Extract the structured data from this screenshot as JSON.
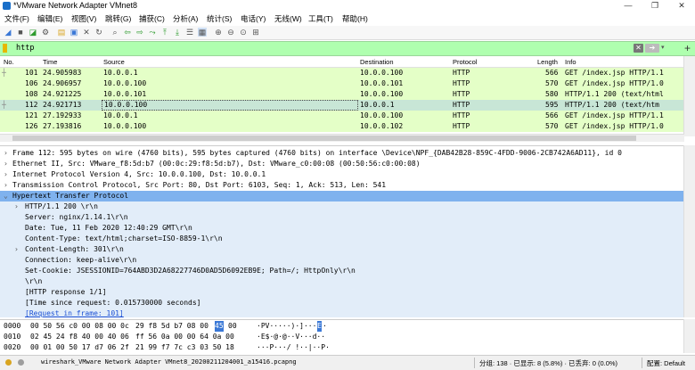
{
  "window": {
    "title": "*VMware Network Adapter VMnet8",
    "min_symbol": "—",
    "max_symbol": "❐",
    "close_symbol": "✕"
  },
  "menu": [
    "文件(F)",
    "编辑(E)",
    "视图(V)",
    "跳转(G)",
    "捕获(C)",
    "分析(A)",
    "统计(S)",
    "电话(Y)",
    "无线(W)",
    "工具(T)",
    "帮助(H)"
  ],
  "toolbar_icons": [
    "shark-fin-start-icon",
    "stop-icon",
    "restart-icon",
    "options-gear-icon",
    "open-file-icon",
    "save-file-icon",
    "close-file-icon",
    "reload-icon",
    "find-icon",
    "back-arrow-icon",
    "forward-arrow-icon",
    "go-to-packet-icon",
    "first-packet-icon",
    "last-packet-icon",
    "autoscroll-icon",
    "colorize-icon",
    "zoom-in-icon",
    "zoom-out-icon",
    "zoom-reset-icon",
    "resize-columns-icon"
  ],
  "filter": {
    "value": "http",
    "clear_symbol": "✕",
    "apply_symbol": "➔",
    "dropdown_symbol": "▾",
    "plus_symbol": "+"
  },
  "packet_list": {
    "columns": [
      "No.",
      "Time",
      "Source",
      "Destination",
      "Protocol",
      "Length",
      "Info"
    ],
    "rows": [
      {
        "no": "101",
        "time": "24.905983",
        "src": "10.0.0.1",
        "dst": "10.0.0.100",
        "proto": "HTTP",
        "len": "566",
        "info": "GET /index.jsp HTTP/1.1"
      },
      {
        "no": "106",
        "time": "24.906957",
        "src": "10.0.0.100",
        "dst": "10.0.0.101",
        "proto": "HTTP",
        "len": "570",
        "info": "GET /index.jsp HTTP/1.0"
      },
      {
        "no": "108",
        "time": "24.921225",
        "src": "10.0.0.101",
        "dst": "10.0.0.100",
        "proto": "HTTP",
        "len": "580",
        "info": "HTTP/1.1 200   (text/html"
      },
      {
        "no": "112",
        "time": "24.921713",
        "src": "10.0.0.100",
        "dst": "10.0.0.1",
        "proto": "HTTP",
        "len": "595",
        "info": "HTTP/1.1 200   (text/htm"
      },
      {
        "no": "121",
        "time": "27.192933",
        "src": "10.0.0.1",
        "dst": "10.0.0.100",
        "proto": "HTTP",
        "len": "566",
        "info": "GET /index.jsp HTTP/1.1"
      },
      {
        "no": "126",
        "time": "27.193816",
        "src": "10.0.0.100",
        "dst": "10.0.0.102",
        "proto": "HTTP",
        "len": "570",
        "info": "GET /index.jsp HTTP/1.0"
      }
    ]
  },
  "details": [
    {
      "arrow": "›",
      "text": "Frame 112: 595 bytes on wire (4760 bits), 595 bytes captured (4760 bits) on interface \\Device\\NPF_{DAB42B28-859C-4FDD-9006-2CB742A6AD11}, id 0"
    },
    {
      "arrow": "›",
      "text": "Ethernet II, Src: VMware_f8:5d:b7 (00:0c:29:f8:5d:b7), Dst: VMware_c0:00:08 (00:50:56:c0:00:08)"
    },
    {
      "arrow": "›",
      "text": "Internet Protocol Version 4, Src: 10.0.0.100, Dst: 10.0.0.1"
    },
    {
      "arrow": "›",
      "text": "Transmission Control Protocol, Src Port: 80, Dst Port: 6103, Seq: 1, Ack: 513, Len: 541"
    },
    {
      "arrow": "⌄",
      "text": "Hypertext Transfer Protocol"
    },
    {
      "arrow": "›",
      "text": "HTTP/1.1 200 \\r\\n"
    },
    {
      "arrow": "",
      "text": "Server: nginx/1.14.1\\r\\n"
    },
    {
      "arrow": "",
      "text": "Date: Tue, 11 Feb 2020 12:40:29 GMT\\r\\n"
    },
    {
      "arrow": "",
      "text": "Content-Type: text/html;charset=ISO-8859-1\\r\\n"
    },
    {
      "arrow": "›",
      "text": "Content-Length: 301\\r\\n"
    },
    {
      "arrow": "",
      "text": "Connection: keep-alive\\r\\n"
    },
    {
      "arrow": "",
      "text": "Set-Cookie: JSESSIONID=764ABD3D2A68227746D0AD5D6092EB9E; Path=/; HttpOnly\\r\\n"
    },
    {
      "arrow": "",
      "text": "\\r\\n"
    },
    {
      "arrow": "",
      "text": "[HTTP response 1/1]"
    },
    {
      "arrow": "",
      "text": "[Time since request: 0.015730000 seconds]"
    },
    {
      "arrow": "",
      "text": "[Request in frame: 101]"
    }
  ],
  "hex": [
    {
      "offset": "0000",
      "bytes_a": "00 50 56 c0 00 08 00 0c",
      "bytes_b": "29 f8 5d b7 08 00",
      "hl": "45",
      "bytes_c": "00",
      "ascii": "·PV·····)·]···",
      "ascii_hl": "E",
      "ascii_tail": "·"
    },
    {
      "offset": "0010",
      "bytes_a": "02 45 24 f8 40 00 40 06",
      "bytes_b": "ff 56 0a 00 00 64 0a 00",
      "hl": "",
      "bytes_c": "",
      "ascii": "·E$·@·@··V···d··",
      "ascii_hl": "",
      "ascii_tail": ""
    },
    {
      "offset": "0020",
      "bytes_a": "00 01 00 50 17 d7 06 2f",
      "bytes_b": "21 99 f7 7c c3 03 50 18",
      "hl": "",
      "bytes_c": "",
      "ascii": "···P···/ !··|··P·",
      "ascii_hl": "",
      "ascii_tail": ""
    }
  ],
  "status": {
    "file": "wireshark_VMware Network Adapter VMnet8_20200211204001_a15416.pcapng",
    "packets": "分组: 138 · 已显示: 8 (5.8%) · 已丢弃: 0 (0.0%)",
    "profile": "配置: Default"
  },
  "colors": {
    "accent": "#3a78d6",
    "filter_ok": "#afffaf",
    "http_row": "#e4ffc7",
    "selected_row": "#c8e6d6"
  }
}
